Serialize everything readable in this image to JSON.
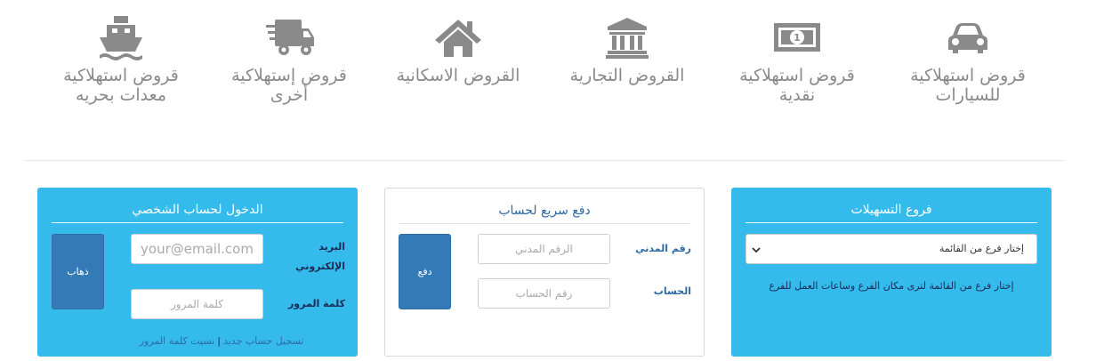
{
  "categories": [
    {
      "label": "قروض استهلاكية\nللسيارات",
      "icon": "car-icon"
    },
    {
      "label": "قروض استهلاكية\nنقدية",
      "icon": "money-icon"
    },
    {
      "label": "القروض التجارية",
      "icon": "bank-icon"
    },
    {
      "label": "القروض الاسكانية",
      "icon": "home-icon"
    },
    {
      "label": "قروض إستهلاكية\nأخرى",
      "icon": "truck-icon"
    },
    {
      "label": "قروض استهلاكية\nمعدات بحريه",
      "icon": "ship-icon"
    }
  ],
  "branches": {
    "title": "فروع التسهيلات",
    "select_value": "إختار فرع من القائمة",
    "note": "إختار فرع من القائمة لترى مكان الفرع وساعات العمل للفرع"
  },
  "quick_pay": {
    "title": "دفع سريع لحساب",
    "civil_label": "رقم المدني",
    "civil_placeholder": "الرقم المدني",
    "account_label": "الحساب",
    "account_placeholder": "رقم الحساب",
    "pay_button": "دفع"
  },
  "login": {
    "title": "الدخول لحساب الشخصي",
    "email_label": "البريد الإلكتروني",
    "email_placeholder": "your@email.com",
    "password_label": "كلمة المرور",
    "password_placeholder": "كلمة المرور",
    "go_button": "ذهاب",
    "register_link": "تسجيل حساب جديد",
    "separator": "|",
    "forgot_link": "نسيت كلمة المرور"
  },
  "colors": {
    "panel_blue": "#35baec",
    "button_blue": "#337ab7",
    "icon_gray": "#8a8a8a"
  }
}
